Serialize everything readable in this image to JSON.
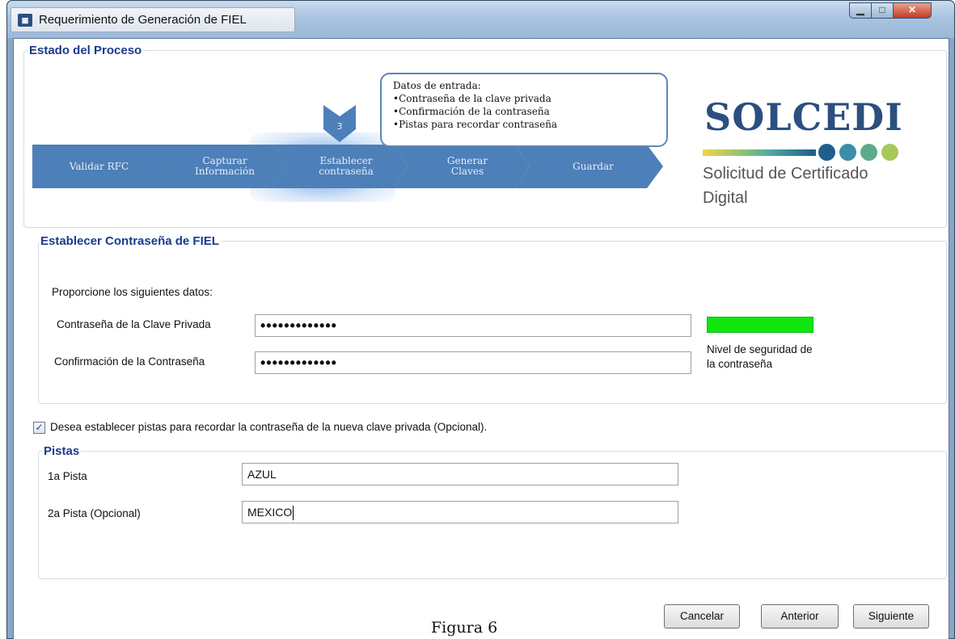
{
  "window": {
    "title": "Requerimiento de Generación de FIEL",
    "icon_label": "FIEL",
    "controls": [
      "minimize",
      "maximize",
      "close"
    ]
  },
  "process": {
    "legend": "Estado del Proceso",
    "steps": [
      {
        "line1": "Validar RFC",
        "line2": ""
      },
      {
        "line1": "Capturar",
        "line2": "Información"
      },
      {
        "line1": "Establecer",
        "line2": "contraseña"
      },
      {
        "line1": "Generar",
        "line2": "Claves"
      },
      {
        "line1": "Guardar",
        "line2": ""
      }
    ],
    "current_step_number": "3",
    "callout": {
      "heading": "Datos de entrada:",
      "items": [
        "•Contraseña de la clave privada",
        "•Confirmación  de la contraseña",
        "•Pistas para recordar contraseña"
      ]
    }
  },
  "logo": {
    "title": "SOLCEDI",
    "subtitle_line1": "Solicitud de Certificado",
    "subtitle_line2": "Digital",
    "dot_colors": [
      "#1f5f8e",
      "#3a8fa8",
      "#5cab8a",
      "#a6c95a"
    ]
  },
  "password_section": {
    "legend": "Establecer Contraseña de FIEL",
    "instruction": "Proporcione los siguientes datos:",
    "password_label": "Contraseña de la Clave Privada",
    "password_value": "•••••••••••••",
    "confirm_label": "Confirmación de la Contraseña",
    "confirm_value": "•••••••••••••",
    "strength_label_line1": "Nivel de seguridad de",
    "strength_label_line2": "la contraseña",
    "strength_color": "#11e60f"
  },
  "hints_checkbox": {
    "checked": true,
    "label": "Desea establecer pistas para recordar la contraseña de la nueva clave privada (Opcional)."
  },
  "hints_section": {
    "legend": "Pistas",
    "hint1_label": "1a Pista",
    "hint1_value": "AZUL",
    "hint2_label": "2a Pista (Opcional)",
    "hint2_value": "MEXICO"
  },
  "buttons": {
    "cancel": "Cancelar",
    "back": "Anterior",
    "next": "Siguiente"
  },
  "caption": "Figura 6"
}
